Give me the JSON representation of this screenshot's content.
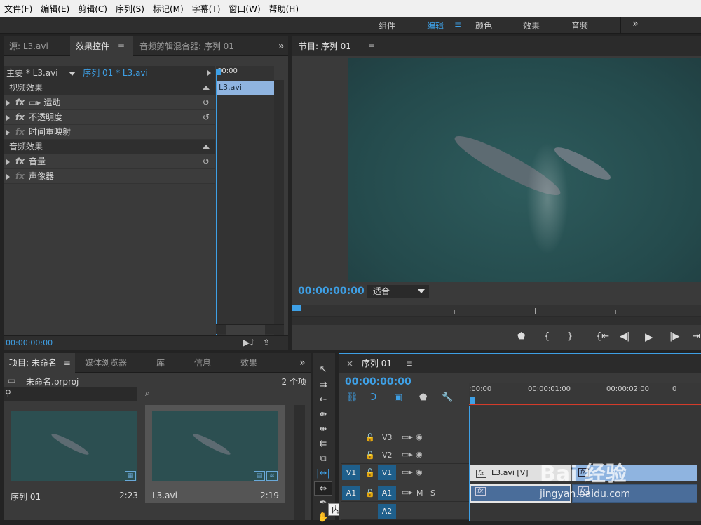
{
  "menu": [
    "文件(F)",
    "编辑(E)",
    "剪辑(C)",
    "序列(S)",
    "标记(M)",
    "字幕(T)",
    "窗口(W)",
    "帮助(H)"
  ],
  "workspaces": {
    "items": [
      "组件",
      "编辑",
      "颜色",
      "效果",
      "音频"
    ],
    "active": "编辑",
    "more": "»"
  },
  "source_panel": {
    "tabs": [
      "源: L3.avi",
      "效果控件",
      "音频剪辑混合器: 序列 01"
    ],
    "more": "»",
    "master_label": "主要 * L3.avi",
    "sequence_label": "序列 01 * L3.avi",
    "ruler_time": "00:00",
    "clip_name": "L3.avi",
    "video_effects_header": "视频效果",
    "video_effects": [
      "运动",
      "不透明度",
      "时间重映射"
    ],
    "audio_effects_header": "音频效果",
    "audio_effects": [
      "音量",
      "声像器"
    ],
    "timecode": "00:00:00:00"
  },
  "program_panel": {
    "title": "节目: 序列 01",
    "timecode": "00:00:00:00",
    "fit_label": "适合"
  },
  "project_panel": {
    "tabs": [
      "项目: 未命名",
      "媒体浏览器",
      "库",
      "信息",
      "效果"
    ],
    "more": "»",
    "file_name": "未命名.prproj",
    "item_count": "2 个项",
    "search_placeholder": "",
    "items": [
      {
        "name": "序列 01",
        "duration": "2:23"
      },
      {
        "name": "L3.avi",
        "duration": "2:19"
      }
    ]
  },
  "tooltip": "内滑工具 (U)",
  "timeline": {
    "title": "序列 01",
    "close": "×",
    "timecode": "00:00:00:00",
    "ruler": [
      ":00:00",
      "00:00:01:00",
      "00:00:02:00"
    ],
    "tracks": {
      "v3": "V3",
      "v2": "V2",
      "v1": "V1",
      "a1": "A1",
      "a2": "A2",
      "mute": "M",
      "solo": "S"
    },
    "clip_label": "L3.avi [V]"
  },
  "watermark": {
    "text": "Bai 经验",
    "url": "jingyan.baidu.com"
  },
  "colors": {
    "accent": "#3ea0e6",
    "clip": "#8fb4e0",
    "playhead_red": "#d43b2a"
  }
}
